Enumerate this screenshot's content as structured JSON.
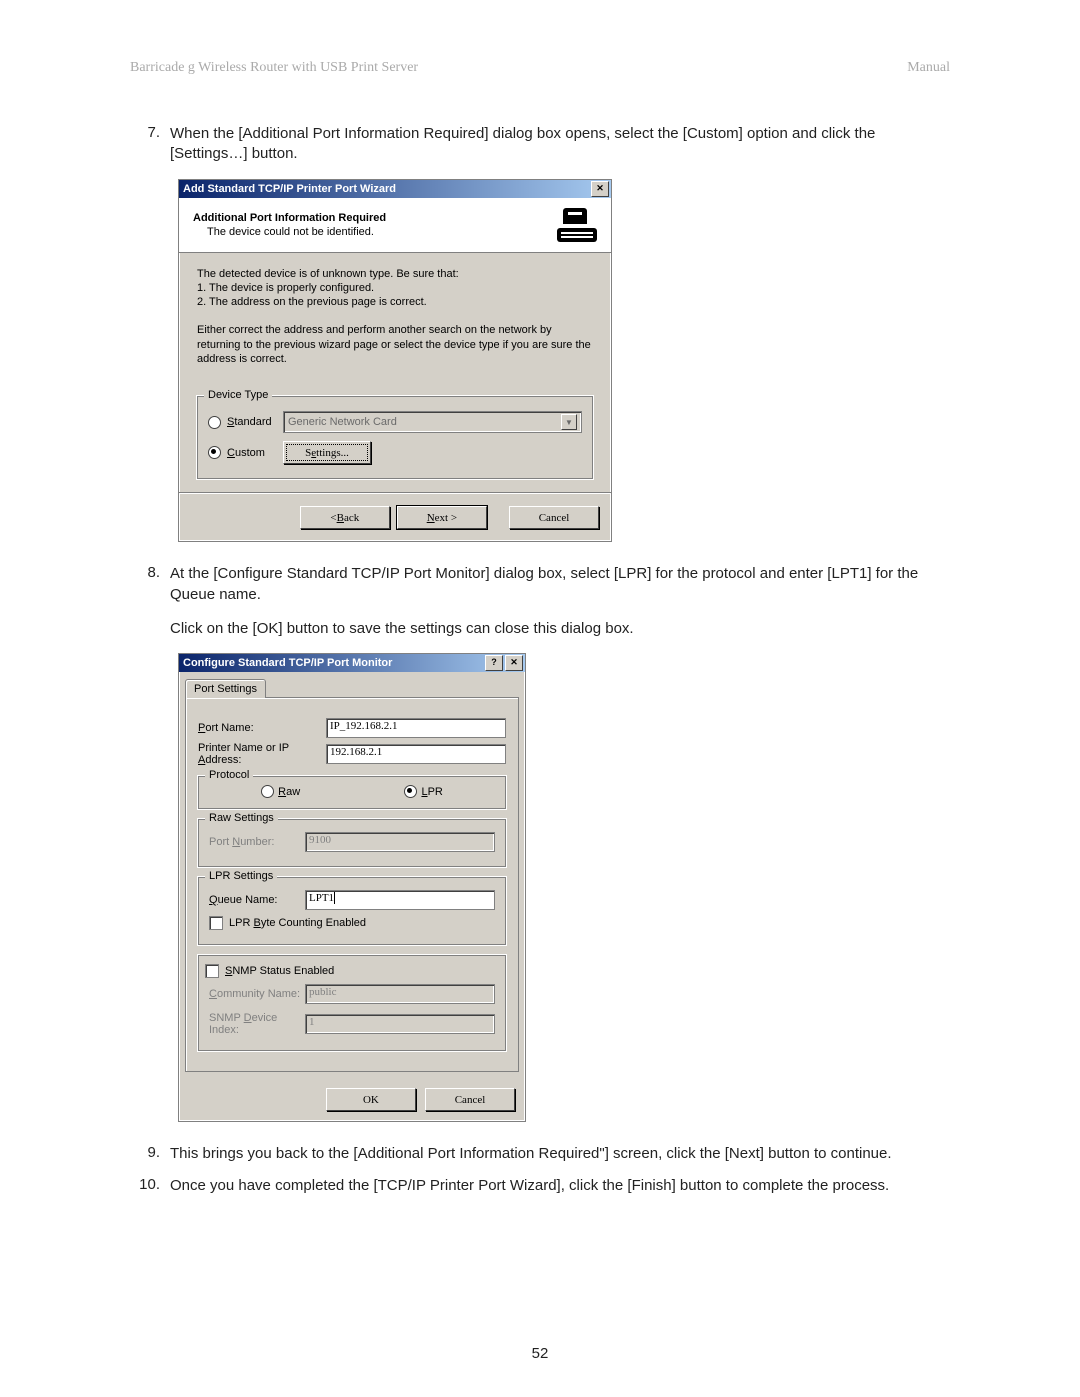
{
  "header": {
    "left": "Barricade g Wireless Router with USB Print Server",
    "right": "Manual"
  },
  "steps": {
    "s7": {
      "num": "7.",
      "text": "When the [Additional Port Information Required] dialog box opens, select the [Custom] option and click the [Settings…] button."
    },
    "s8": {
      "num": "8.",
      "text": "At the [Configure Standard TCP/IP Port Monitor] dialog box, select [LPR] for the protocol and enter [LPT1] for the Queue name.",
      "text2": "Click on the [OK] button to save the settings can close this dialog box."
    },
    "s9": {
      "num": "9.",
      "text": "This brings you back to the [Additional Port Information Required\"] screen, click the [Next] button to continue."
    },
    "s10": {
      "num": "10.",
      "text": "Once you have completed the [TCP/IP Printer Port Wizard], click the [Finish] button to complete the process."
    }
  },
  "dlg1": {
    "title": "Add Standard TCP/IP Printer Port Wizard",
    "banner_title": "Additional Port Information Required",
    "banner_sub": "The device could not be identified.",
    "p1": "The detected device is of unknown type.  Be sure that:",
    "p1a": "1.  The device is properly configured.",
    "p1b": "2.  The address on the previous page is correct.",
    "p2": "Either correct the address and perform another search on the network by returning to the previous wizard page or select the device type if you are sure the address is correct.",
    "group_legend": "Device Type",
    "radio_standard": "Standard",
    "radio_custom": "Custom",
    "select_value": "Generic Network Card",
    "btn_settings": "Settings...",
    "btn_back": "< Back",
    "btn_next": "Next >",
    "btn_cancel": "Cancel"
  },
  "dlg2": {
    "title": "Configure Standard TCP/IP Port Monitor",
    "tab": "Port Settings",
    "port_name_lbl": "Port Name:",
    "port_name_val": "IP_192.168.2.1",
    "ip_lbl": "Printer Name or IP Address:",
    "ip_val": "192.168.2.1",
    "protocol_legend": "Protocol",
    "radio_raw": "Raw",
    "radio_lpr": "LPR",
    "raw_legend": "Raw Settings",
    "raw_port_lbl": "Port Number:",
    "raw_port_val": "9100",
    "lpr_legend": "LPR Settings",
    "queue_lbl": "Queue Name:",
    "queue_val": "LPT1",
    "lpr_byte": "LPR Byte Counting Enabled",
    "snmp_chk": "SNMP Status Enabled",
    "snmp_comm_lbl": "Community Name:",
    "snmp_comm_val": "public",
    "snmp_idx_lbl": "SNMP Device Index:",
    "snmp_idx_val": "1",
    "btn_ok": "OK",
    "btn_cancel": "Cancel"
  },
  "page_number": "52"
}
